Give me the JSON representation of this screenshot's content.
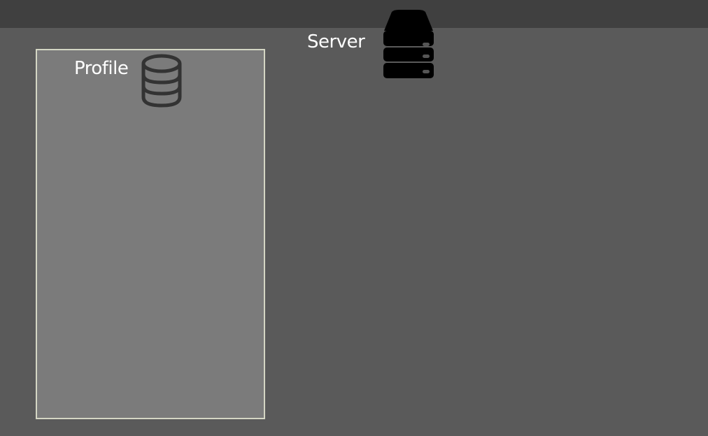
{
  "server": {
    "label": "Server",
    "icon": "server-icon"
  },
  "profile": {
    "label": "Profile",
    "icon": "database-icon"
  },
  "colors": {
    "background": "#5a5a5a",
    "topbar": "#404040",
    "profile_box": "#7b7b7b",
    "profile_border": "#d4d6c4"
  }
}
